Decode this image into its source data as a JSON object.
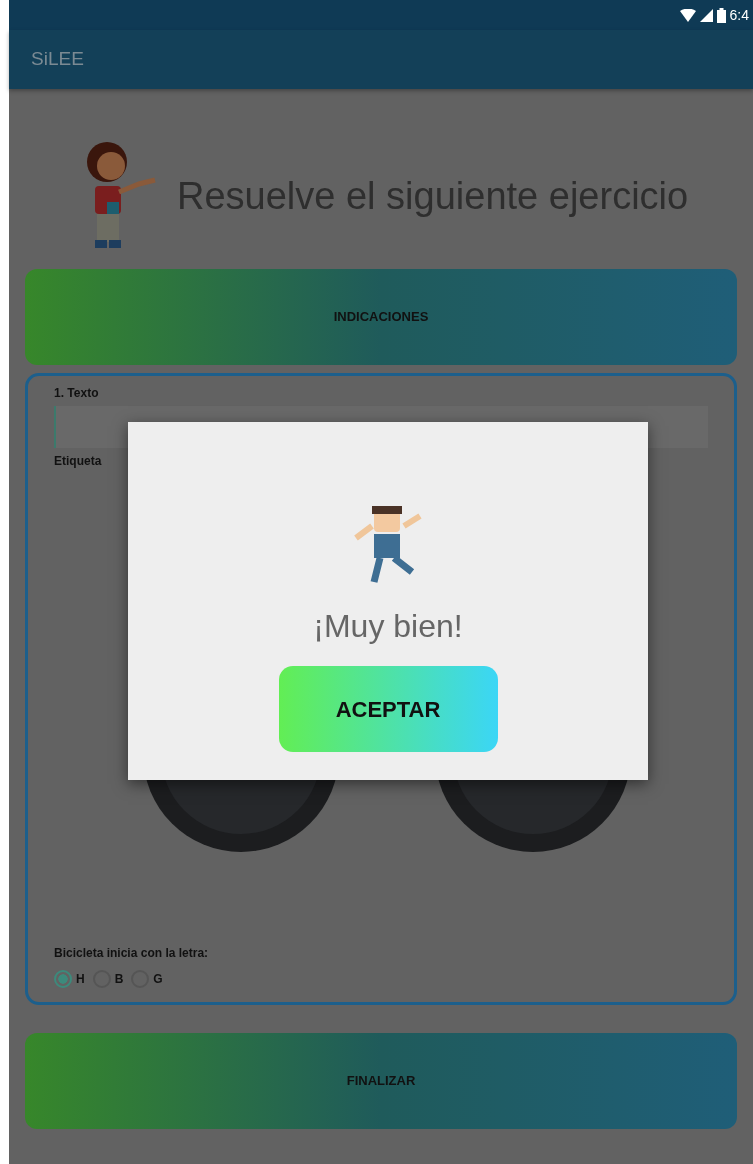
{
  "status_bar": {
    "time": "6:4"
  },
  "app_bar": {
    "title": "SiLEE"
  },
  "header": {
    "title": "Resuelve el siguiente ejercicio"
  },
  "indications_button": {
    "label": "INDICACIONES"
  },
  "exercise": {
    "title": "1. Texto",
    "label": "Etiqueta",
    "question": "Bicicleta inicia con la letra:",
    "options": [
      {
        "label": "H",
        "selected": true
      },
      {
        "label": "B",
        "selected": false
      },
      {
        "label": "G",
        "selected": false
      }
    ]
  },
  "finish_button": {
    "label": "FINALIZAR"
  },
  "dialog": {
    "message": "¡Muy bien!",
    "button": "ACEPTAR"
  }
}
